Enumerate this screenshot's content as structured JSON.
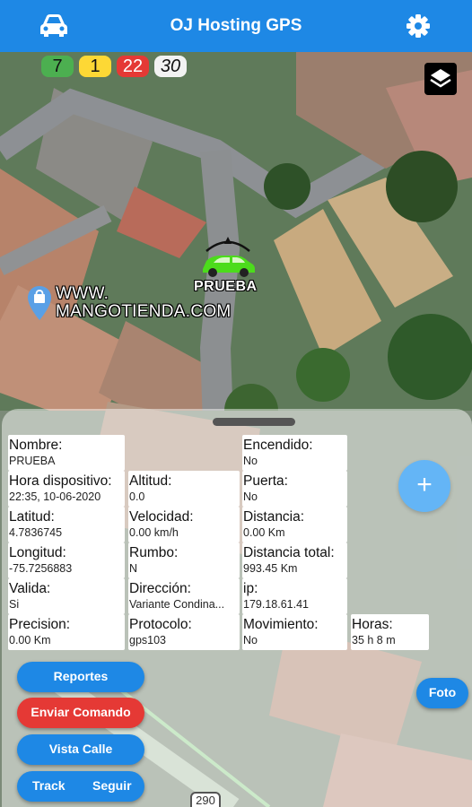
{
  "header": {
    "title": "OJ Hosting GPS",
    "left_icon": "car-icon",
    "right_icon": "gear-icon",
    "color": "#1e88e5"
  },
  "counters": [
    {
      "value": "7",
      "color": "#4caf50"
    },
    {
      "value": "1",
      "color": "#fdd835"
    },
    {
      "value": "22",
      "color": "#e53935"
    },
    {
      "value": "30",
      "color": "#f2f2f2"
    }
  ],
  "map": {
    "layers_icon": "layers-icon",
    "poi_icon": "location-bag-icon",
    "poi_line1": "WWW.",
    "poi_line2": "MANGOTIENDA.COM",
    "vehicle_name": "PRUEBA",
    "vehicle_color": "#4cdc1c",
    "road_shield": "290"
  },
  "details": {
    "nombre": {
      "label": "Nombre:",
      "value": "PRUEBA"
    },
    "hora": {
      "label": "Hora dispositivo:",
      "value": "22:35, 10-06-2020"
    },
    "latitud": {
      "label": "Latitud:",
      "value": "4.7836745"
    },
    "longitud": {
      "label": "Longitud:",
      "value": "-75.7256883"
    },
    "valida": {
      "label": "Valida:",
      "value": "Si"
    },
    "precision": {
      "label": "Precision:",
      "value": "0.00 Km"
    },
    "altitud": {
      "label": "Altitud:",
      "value": "0.0"
    },
    "velocidad": {
      "label": "Velocidad:",
      "value": "0.00 km/h"
    },
    "rumbo": {
      "label": "Rumbo:",
      "value": "N"
    },
    "direccion": {
      "label": "Dirección:",
      "value": "Variante Condina..."
    },
    "protocolo": {
      "label": "Protocolo:",
      "value": "gps103"
    },
    "encendido": {
      "label": "Encendido:",
      "value": "No"
    },
    "puerta": {
      "label": "Puerta:",
      "value": "No"
    },
    "distancia": {
      "label": "Distancia:",
      "value": "0.00 Km"
    },
    "distancia_total": {
      "label": "Distancia total:",
      "value": "993.45 Km"
    },
    "ip": {
      "label": "ip:",
      "value": "179.18.61.41"
    },
    "movimiento": {
      "label": "Movimiento:",
      "value": "No"
    },
    "horas": {
      "label": "Horas:",
      "value": "35 h 8 m"
    }
  },
  "actions": {
    "fab_icon": "plus-icon",
    "fab_label": "+",
    "reportes": "Reportes",
    "enviar": "Enviar Comando",
    "vista": "Vista Calle",
    "track": "Track",
    "seguir": "Seguir",
    "foto": "Foto"
  }
}
